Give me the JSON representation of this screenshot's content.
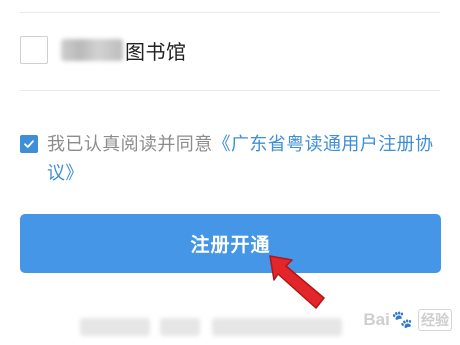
{
  "library": {
    "name_suffix": "图书馆",
    "checked": false
  },
  "agreement": {
    "text": "我已认真阅读并同意",
    "link": "《广东省粤读通用户注册协议》",
    "checked": true
  },
  "register_button": {
    "label": "注册开通"
  },
  "watermark": {
    "text": "Bai",
    "paw": "🐾",
    "suffix": "经验"
  },
  "colors": {
    "accent": "#4596e6",
    "link": "#3e8ed8",
    "arrow": "#e3262a",
    "muted_text": "#8c8c8c"
  }
}
